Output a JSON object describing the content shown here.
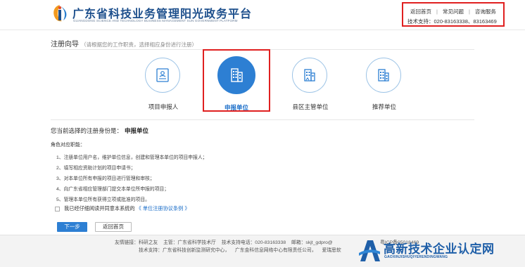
{
  "header": {
    "title": "广东省科技业务管理阳光政务平台",
    "subtitle": "GUANGDONG SCIENCE AND TECHNOLOGY BUSINESS MANAGEMENT SUN GOVERNMENT PLATFORM",
    "links": [
      "返回首页",
      "常见问题",
      "咨询服务"
    ],
    "support": "技术支持：020-83163338、83163469"
  },
  "wizard": {
    "title": "注册向导",
    "hint": "（请根据您的工作职责，选择相应身份进行注册）",
    "roles": [
      {
        "label": "项目申报人",
        "icon": "id-card-icon",
        "active": false
      },
      {
        "label": "申报单位",
        "icon": "building-icon",
        "active": true
      },
      {
        "label": "县区主管单位",
        "icon": "office-building-icon",
        "active": false
      },
      {
        "label": "推荐单位",
        "icon": "recommend-building-icon",
        "active": false
      }
    ]
  },
  "selection": {
    "prefix": "您当前选择的注册身份是：",
    "value": "申报单位"
  },
  "duties": {
    "title": "角色对应职能：",
    "items": [
      "1、注册单位用户名，维护单位信息，创建和管理本单位的项目申报人；",
      "2、填写相应资助计划的项目申请书；",
      "3、对本单位所有申报的项目进行管理和审核；",
      "4、向广东省相应管理部门提交本单位所申报的项目；",
      "5、管理本单位所有获得立项或批准的项目。"
    ]
  },
  "agreement": {
    "text": "我已经仔细阅读并同意本系统的",
    "terms": "《 单位注册协议条例 》"
  },
  "buttons": {
    "next": "下一步",
    "home": "返回首页"
  },
  "footer": {
    "row1": [
      "友情链接：科研之友",
      "主管：广东省科学技术厅",
      "技术支持电话：020-83163338",
      "邮箱：skjt_gdpro@"
    ],
    "icp": "粤ICP备05018469",
    "row2": [
      "技术支持：广东省科技创新监测研究中心，",
      "广东金科信息网络中心有限责任公司，",
      "爱瑞思软"
    ]
  },
  "watermark": {
    "cn": "高新技术企业认定网",
    "en": "GAOXINJISHUQIYERENDINGWANG"
  },
  "colors": {
    "brand": "#1d4f8c",
    "accent": "#2d7fd3",
    "highlight": "#e02020"
  }
}
